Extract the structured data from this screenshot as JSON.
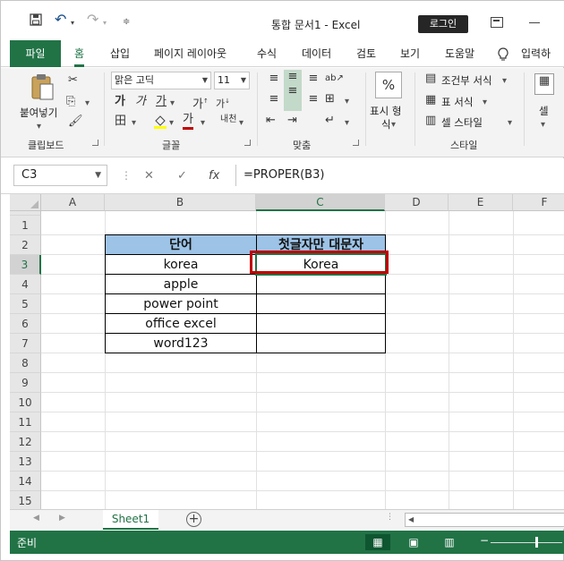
{
  "titlebar": {
    "title": "통합 문서1  -  Excel",
    "login": "로그인"
  },
  "tabs": {
    "file": "파일",
    "items": [
      "홈",
      "삽입",
      "페이지 레이아웃",
      "수식",
      "데이터",
      "검토",
      "보기",
      "도움말"
    ],
    "search": "입력하"
  },
  "ribbon": {
    "clipboard": {
      "label": "클립보드",
      "paste": "붙여넣기"
    },
    "font": {
      "label": "글꼴",
      "name": "맑은 고딕",
      "size": "11",
      "bold": "가",
      "italic": "가",
      "underline": "가"
    },
    "align": {
      "label": "맞춤"
    },
    "number": {
      "label": "표시 형식",
      "line1": "표시 형",
      "line2": "식"
    },
    "styles": {
      "label": "스타일",
      "conditional": "조건부 서식",
      "table": "표 서식",
      "cell": "셀 스타일"
    },
    "cells": {
      "label": "셀"
    }
  },
  "formula_bar": {
    "name_box": "C3",
    "formula": "=PROPER(B3)"
  },
  "sheet": {
    "columns": [
      "A",
      "B",
      "C",
      "D",
      "E",
      "F"
    ],
    "rows": [
      "1",
      "2",
      "3",
      "4",
      "5",
      "6",
      "7",
      "8",
      "9",
      "10",
      "11",
      "12",
      "13",
      "14",
      "15"
    ],
    "header_b": "단어",
    "header_c": "첫글자만 대문자",
    "b_values": [
      "korea",
      "apple",
      "power point",
      "office excel",
      "word123"
    ],
    "c_values": [
      "Korea",
      "",
      "",
      "",
      ""
    ],
    "active_cell": "C3"
  },
  "sheet_tabs": {
    "active": "Sheet1"
  },
  "status": {
    "text": "준비"
  },
  "colors": {
    "accent": "#217346",
    "table_header": "#9dc3e6",
    "highlight": "#c00000"
  }
}
